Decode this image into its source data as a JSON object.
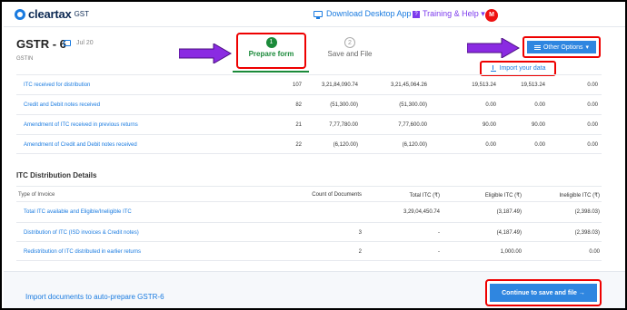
{
  "header": {
    "brand": "cleartax",
    "brand_suffix": "GST",
    "download_link": "Download Desktop App",
    "help_link": "Training & Help ▾",
    "avatar": "M"
  },
  "page": {
    "title": "GSTR - 6",
    "period": "Jul 20",
    "gstin_label": "GSTIN"
  },
  "steps": [
    {
      "number": "1",
      "label": "Prepare form",
      "active": true
    },
    {
      "number": "2",
      "label": "Save and File",
      "active": false
    }
  ],
  "actions": {
    "other_options": "Other Options",
    "other_options_caret": "▾",
    "import_data": "Import your data"
  },
  "summary_rows": [
    {
      "label": "ITC received for distribution",
      "count": "107",
      "c1": "3,21,84,090.74",
      "c2": "3,21,45,064.26",
      "c3": "19,513.24",
      "c4": "19,513.24",
      "c5": "0.00"
    },
    {
      "label": "Credit and Debit notes received",
      "count": "82",
      "c1": "(51,300.00)",
      "c2": "(51,300.00)",
      "c3": "0.00",
      "c4": "0.00",
      "c5": "0.00"
    },
    {
      "label": "Amendment of ITC received in previous returns",
      "count": "21",
      "c1": "7,77,780.00",
      "c2": "7,77,600.00",
      "c3": "90.00",
      "c4": "90.00",
      "c5": "0.00"
    },
    {
      "label": "Amendment of Credit and Debit notes received",
      "count": "22",
      "c1": "(6,120.00)",
      "c2": "(6,120.00)",
      "c3": "0.00",
      "c4": "0.00",
      "c5": "0.00"
    }
  ],
  "distribution": {
    "title": "ITC Distribution Details",
    "columns": [
      "Type of Invoice",
      "Count of Documents",
      "Total ITC (₹)",
      "Eligible ITC (₹)",
      "Ineligible ITC (₹)"
    ],
    "rows": [
      {
        "label": "Total ITC available and Eligible/Ineligible ITC",
        "count": "",
        "total": "3,29,04,450.74",
        "eligible": "(3,187.49)",
        "ineligible": "(2,398.03)"
      },
      {
        "label": "Distribution of ITC (ISD invoices & Credit notes)",
        "count": "3",
        "total": "-",
        "eligible": "(4,187.49)",
        "ineligible": "(2,398.03)"
      },
      {
        "label": "Redistribution of ITC distributed in earlier returns",
        "count": "2",
        "total": "-",
        "eligible": "1,000.00",
        "ineligible": "0.00"
      }
    ]
  },
  "footer": {
    "import_link": "Import documents to auto-prepare GSTR-6",
    "continue_button": "Continue to save and file →"
  },
  "colors": {
    "accent": "#2f86e0",
    "highlight": "#e00000",
    "annotation_arrow": "#8a2be2",
    "success": "#1b8a3a"
  }
}
